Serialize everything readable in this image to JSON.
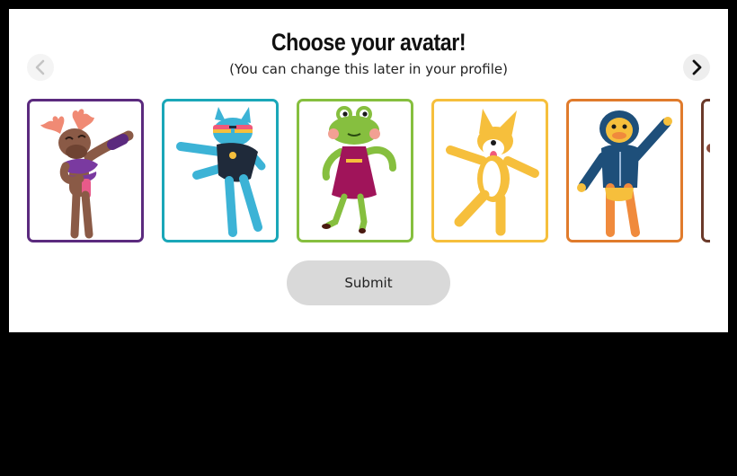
{
  "dialog": {
    "title": "Choose your avatar!",
    "subtitle": "(You can change this later in your profile)",
    "submit_label": "Submit"
  },
  "navigation": {
    "prev_icon": "chevron-left-icon",
    "next_icon": "chevron-right-icon"
  },
  "avatars": [
    {
      "character": "moose",
      "border_color": "#5b2a7e"
    },
    {
      "character": "cat",
      "border_color": "#1aa7b8"
    },
    {
      "character": "frog",
      "border_color": "#86bf3f"
    },
    {
      "character": "corgi",
      "border_color": "#f6bf3c"
    },
    {
      "character": "duck",
      "border_color": "#e07b2c"
    },
    {
      "character": "partial",
      "border_color": "#6b3a2a"
    }
  ],
  "colors": {
    "backdrop": "#000000",
    "panel": "#ffffff",
    "submit_bg": "#d9d9d9"
  }
}
